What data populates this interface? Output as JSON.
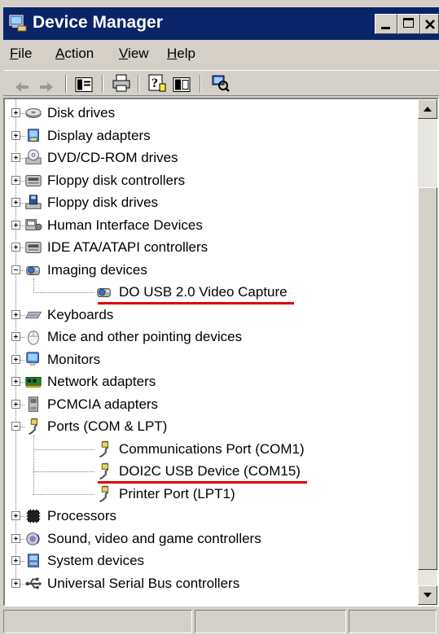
{
  "window": {
    "title": "Device Manager",
    "icon": "device-manager-icon"
  },
  "menu": [
    "File",
    "Action",
    "View",
    "Help"
  ],
  "toolbar": [
    "back-arrow-icon",
    "forward-arrow-icon",
    "show-hide-tree-icon",
    "print-icon",
    "help-icon",
    "properties-icon",
    "scan-hardware-icon"
  ],
  "tree": [
    {
      "label": "Disk drives",
      "icon": "disk-drive-icon",
      "expanded": false
    },
    {
      "label": "Display adapters",
      "icon": "display-adapter-icon",
      "expanded": false
    },
    {
      "label": "DVD/CD-ROM drives",
      "icon": "cdrom-icon",
      "expanded": false
    },
    {
      "label": "Floppy disk controllers",
      "icon": "floppy-controller-icon",
      "expanded": false
    },
    {
      "label": "Floppy disk drives",
      "icon": "floppy-drive-icon",
      "expanded": false
    },
    {
      "label": "Human Interface Devices",
      "icon": "hid-icon",
      "expanded": false
    },
    {
      "label": "IDE ATA/ATAPI controllers",
      "icon": "ide-controller-icon",
      "expanded": false
    },
    {
      "label": "Imaging devices",
      "icon": "camera-icon",
      "expanded": true,
      "children": [
        {
          "label": "DO USB 2.0 Video Capture",
          "icon": "camera-icon",
          "highlighted": true
        }
      ]
    },
    {
      "label": "Keyboards",
      "icon": "keyboard-icon",
      "expanded": false
    },
    {
      "label": "Mice and other pointing devices",
      "icon": "mouse-icon",
      "expanded": false
    },
    {
      "label": "Monitors",
      "icon": "monitor-icon",
      "expanded": false
    },
    {
      "label": "Network adapters",
      "icon": "network-adapter-icon",
      "expanded": false
    },
    {
      "label": "PCMCIA adapters",
      "icon": "pcmcia-icon",
      "expanded": false
    },
    {
      "label": "Ports (COM & LPT)",
      "icon": "port-icon",
      "expanded": true,
      "children": [
        {
          "label": "Communications Port (COM1)",
          "icon": "port-icon",
          "highlighted": false
        },
        {
          "label": "DOI2C USB Device (COM15)",
          "icon": "port-icon",
          "highlighted": true
        },
        {
          "label": "Printer Port (LPT1)",
          "icon": "port-icon",
          "highlighted": false
        }
      ]
    },
    {
      "label": "Processors",
      "icon": "processor-icon",
      "expanded": false
    },
    {
      "label": "Sound, video and game controllers",
      "icon": "sound-icon",
      "expanded": false
    },
    {
      "label": "System devices",
      "icon": "system-device-icon",
      "expanded": false
    },
    {
      "label": "Universal Serial Bus controllers",
      "icon": "usb-icon",
      "expanded": false
    }
  ],
  "colors": {
    "titlebar": "#0a246a",
    "highlight_underline": "#e00000",
    "chrome": "#d4d0c8"
  }
}
